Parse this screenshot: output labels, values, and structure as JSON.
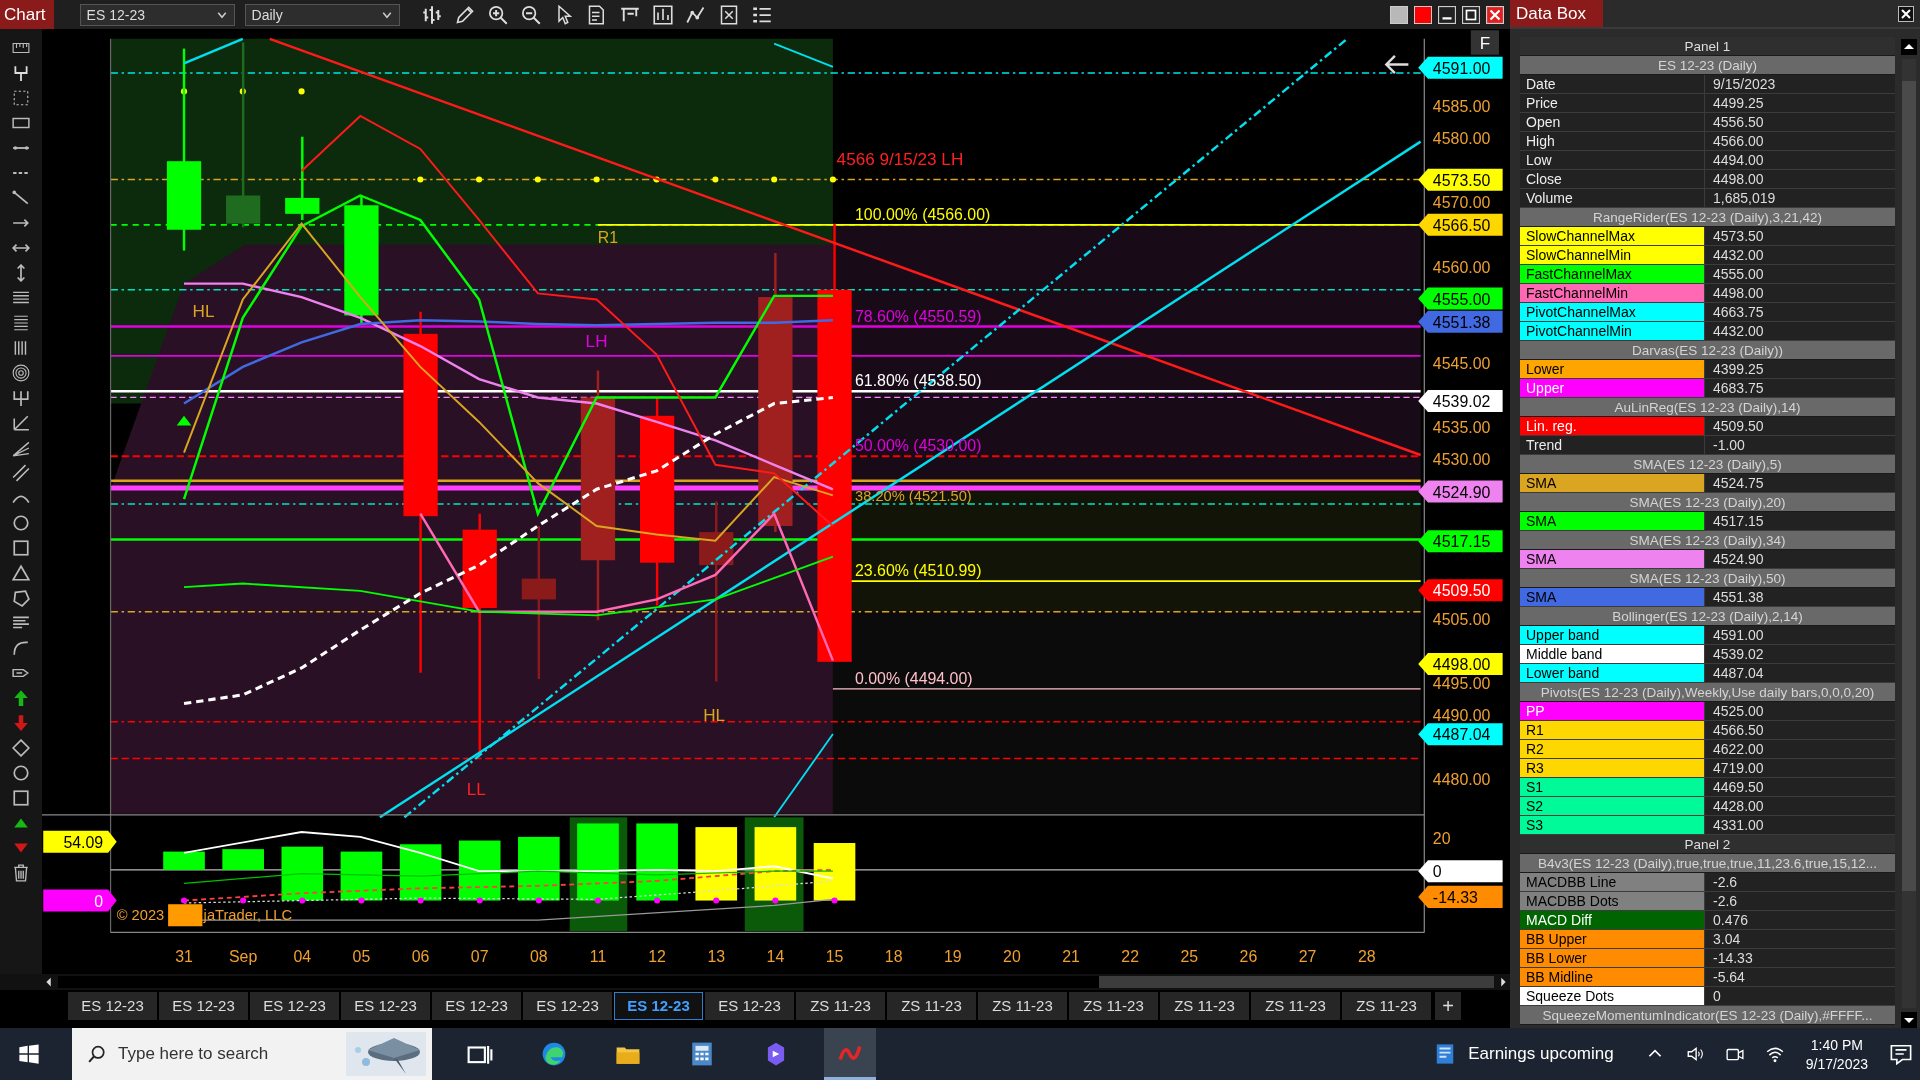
{
  "window": {
    "title": "Chart"
  },
  "toolbar": {
    "instrument": "ES 12-23",
    "interval": "Daily"
  },
  "chart": {
    "flag": "F",
    "price_ticks": [
      "4585.00",
      "4580.00",
      "4570.00",
      "4560.00",
      "4545.00",
      "4535.00",
      "4530.00",
      "4505.00",
      "4495.00",
      "4490.00",
      "4480.00"
    ],
    "price_tags": [
      {
        "text": "4591.00",
        "color": "#00ffff"
      },
      {
        "text": "4573.50",
        "color": "#ffff00"
      },
      {
        "text": "4566.50",
        "color": "#ffd700"
      },
      {
        "text": "4555.00",
        "color": "#00ff00"
      },
      {
        "text": "4551.38",
        "color": "#4169e1"
      },
      {
        "text": "4539.02",
        "color": "#ffffff"
      },
      {
        "text": "4524.90",
        "color": "#ee82ee"
      },
      {
        "text": "4517.15",
        "color": "#00ff00"
      },
      {
        "text": "4509.50",
        "color": "#ff0000"
      },
      {
        "text": "4498.00",
        "color": "#ffff00"
      },
      {
        "text": "4487.04",
        "color": "#00ffff"
      }
    ],
    "annotations": [
      {
        "text": "4566 9/15/23 LH",
        "color": "#ff2020"
      },
      {
        "text": "100.00% (4566.00)",
        "color": "#ffff00"
      },
      {
        "text": "R1",
        "color": "#daa520"
      },
      {
        "text": "HL",
        "color": "#daa520"
      },
      {
        "text": "78.60% (4550.59)",
        "color": "#e000e0"
      },
      {
        "text": "LH",
        "color": "#e000e0"
      },
      {
        "text": "61.80% (4538.50)",
        "color": "#ffffff"
      },
      {
        "text": "50.00% (4530.00)",
        "color": "#e000e0"
      },
      {
        "text": "38.20% (4521.50)",
        "color": "#daa520"
      },
      {
        "text": "23.60% (4510.99)",
        "color": "#ffff00"
      },
      {
        "text": "0.00% (4494.00)",
        "color": "#ffc0cb"
      },
      {
        "text": "HL",
        "color": "#daa520"
      },
      {
        "text": "LL",
        "color": "#ff2020"
      }
    ],
    "date_labels": [
      "31",
      "Sep",
      "04",
      "05",
      "06",
      "07",
      "08",
      "11",
      "12",
      "13",
      "14",
      "15",
      "18",
      "19",
      "20",
      "21",
      "22",
      "25",
      "26",
      "27",
      "28"
    ]
  },
  "indicator_panel": {
    "tick": "20",
    "left_tags": [
      {
        "text": "54.09",
        "color": "#ffff00"
      },
      {
        "text": "0",
        "color": "#ff00ff"
      }
    ],
    "right_tags": [
      {
        "text": "0",
        "color": "#ffffff"
      },
      {
        "text": "-14.33",
        "color": "#ff8c00"
      }
    ],
    "copyright": [
      "© 2023",
      "jaTrader, LLC"
    ]
  },
  "tabs": [
    {
      "label": "ES 12-23",
      "selected": false
    },
    {
      "label": "ES 12-23",
      "selected": false
    },
    {
      "label": "ES 12-23",
      "selected": false
    },
    {
      "label": "ES 12-23",
      "selected": false
    },
    {
      "label": "ES 12-23",
      "selected": false
    },
    {
      "label": "ES 12-23",
      "selected": false
    },
    {
      "label": "ES 12-23",
      "selected": true
    },
    {
      "label": "ES 12-23",
      "selected": false
    },
    {
      "label": "ZS 11-23",
      "selected": false
    },
    {
      "label": "ZS 11-23",
      "selected": false
    },
    {
      "label": "ZS 11-23",
      "selected": false
    },
    {
      "label": "ZS 11-23",
      "selected": false
    },
    {
      "label": "ZS 11-23",
      "selected": false
    },
    {
      "label": "ZS 11-23",
      "selected": false
    },
    {
      "label": "ZS 11-23",
      "selected": false
    }
  ],
  "add_tab": "+",
  "data_box": {
    "title": "Data Box",
    "sections": [
      {
        "kind": "panel",
        "label": "Panel 1"
      },
      {
        "kind": "header",
        "label": "ES 12-23 (Daily)"
      },
      {
        "kind": "row",
        "label": "Date",
        "value": "9/15/2023"
      },
      {
        "kind": "row",
        "label": "Price",
        "value": "4499.25"
      },
      {
        "kind": "row",
        "label": "Open",
        "value": "4556.50"
      },
      {
        "kind": "row",
        "label": "High",
        "value": "4566.00"
      },
      {
        "kind": "row",
        "label": "Low",
        "value": "4494.00"
      },
      {
        "kind": "row",
        "label": "Close",
        "value": "4498.00"
      },
      {
        "kind": "row",
        "label": "Volume",
        "value": "1,685,019"
      },
      {
        "kind": "header",
        "label": "RangeRider(ES 12-23 (Daily),3,21,42)"
      },
      {
        "kind": "row",
        "label": "SlowChannelMax",
        "value": "4573.50",
        "color": "#ffff00"
      },
      {
        "kind": "row",
        "label": "SlowChannelMin",
        "value": "4432.00",
        "color": "#ffff00"
      },
      {
        "kind": "row",
        "label": "FastChannelMax",
        "value": "4555.00",
        "color": "#00ff00"
      },
      {
        "kind": "row",
        "label": "FastChannelMin",
        "value": "4498.00",
        "color": "#ff69b4"
      },
      {
        "kind": "row",
        "label": "PivotChannelMax",
        "value": "4663.75",
        "color": "#00ffff"
      },
      {
        "kind": "row",
        "label": "PivotChannelMin",
        "value": "4432.00",
        "color": "#00ffff"
      },
      {
        "kind": "header",
        "label": "Darvas(ES 12-23 (Daily))"
      },
      {
        "kind": "row",
        "label": "Lower",
        "value": "4399.25",
        "color": "#ffa500"
      },
      {
        "kind": "row",
        "label": "Upper",
        "value": "4683.75",
        "color": "#ff00ff"
      },
      {
        "kind": "header",
        "label": "AuLinReg(ES 12-23 (Daily),14)"
      },
      {
        "kind": "row",
        "label": "Lin. reg.",
        "value": "4509.50",
        "color": "#ff0000"
      },
      {
        "kind": "row",
        "label": "Trend",
        "value": "-1.00"
      },
      {
        "kind": "header",
        "label": "SMA(ES 12-23 (Daily),5)"
      },
      {
        "kind": "row",
        "label": "SMA",
        "value": "4524.75",
        "color": "#daa520"
      },
      {
        "kind": "header",
        "label": "SMA(ES 12-23 (Daily),20)"
      },
      {
        "kind": "row",
        "label": "SMA",
        "value": "4517.15",
        "color": "#00ff00"
      },
      {
        "kind": "header",
        "label": "SMA(ES 12-23 (Daily),34)"
      },
      {
        "kind": "row",
        "label": "SMA",
        "value": "4524.90",
        "color": "#ee82ee"
      },
      {
        "kind": "header",
        "label": "SMA(ES 12-23 (Daily),50)"
      },
      {
        "kind": "row",
        "label": "SMA",
        "value": "4551.38",
        "color": "#4169e1"
      },
      {
        "kind": "header",
        "label": "Bollinger(ES 12-23 (Daily),2,14)"
      },
      {
        "kind": "row",
        "label": "Upper band",
        "value": "4591.00",
        "color": "#00ffff"
      },
      {
        "kind": "row",
        "label": "Middle band",
        "value": "4539.02",
        "color": "#ffffff"
      },
      {
        "kind": "row",
        "label": "Lower band",
        "value": "4487.04",
        "color": "#00ffff"
      },
      {
        "kind": "header",
        "label": "Pivots(ES 12-23 (Daily),Weekly,Use daily bars,0,0,0,20)"
      },
      {
        "kind": "row",
        "label": "PP",
        "value": "4525.00",
        "color": "#ff00ff"
      },
      {
        "kind": "row",
        "label": "R1",
        "value": "4566.50",
        "color": "#ffd700"
      },
      {
        "kind": "row",
        "label": "R2",
        "value": "4622.00",
        "color": "#ffd700"
      },
      {
        "kind": "row",
        "label": "R3",
        "value": "4719.00",
        "color": "#ffd700"
      },
      {
        "kind": "row",
        "label": "S1",
        "value": "4469.50",
        "color": "#00fa9a"
      },
      {
        "kind": "row",
        "label": "S2",
        "value": "4428.00",
        "color": "#00fa9a"
      },
      {
        "kind": "row",
        "label": "S3",
        "value": "4331.00",
        "color": "#00fa9a"
      },
      {
        "kind": "panel",
        "label": "Panel 2"
      },
      {
        "kind": "header",
        "label": "B4v3(ES 12-23 (Daily),true,true,true,11,23.6,true,15,12..."
      },
      {
        "kind": "row",
        "label": "MACDBB Line",
        "value": "-2.6",
        "color": "#808080"
      },
      {
        "kind": "row",
        "label": "MACDBB Dots",
        "value": "-2.6",
        "color": "#808080"
      },
      {
        "kind": "row",
        "label": "MACD Diff",
        "value": "0.476",
        "color": "#006400"
      },
      {
        "kind": "row",
        "label": "BB Upper",
        "value": "3.04",
        "color": "#ff8c00"
      },
      {
        "kind": "row",
        "label": "BB Lower",
        "value": "-14.33",
        "color": "#ff8c00"
      },
      {
        "kind": "row",
        "label": "BB Midline",
        "value": "-5.64",
        "color": "#ff8c00"
      },
      {
        "kind": "row",
        "label": "Squeeze Dots",
        "value": "0",
        "color": "#ffffff"
      },
      {
        "kind": "header",
        "label": "SqueezeMomentumIndicator(ES 12-23 (Daily),#FFFF..."
      }
    ]
  },
  "taskbar": {
    "search": {
      "placeholder": "Type here to search"
    },
    "news": "Earnings upcoming",
    "time": "1:40 PM",
    "date": "9/17/2023"
  }
}
